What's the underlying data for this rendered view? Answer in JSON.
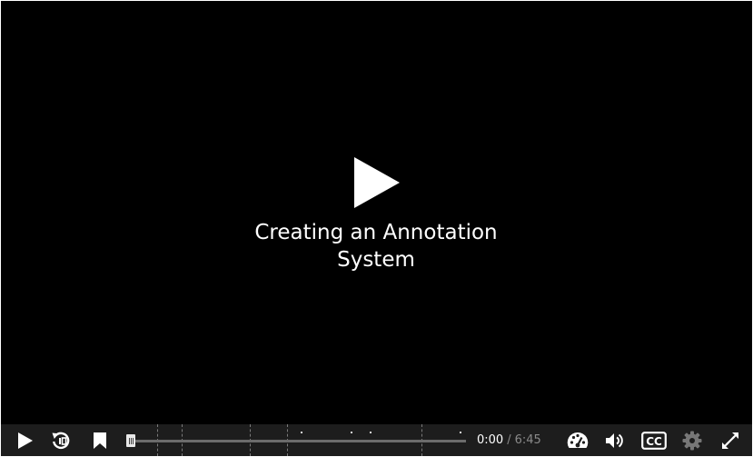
{
  "video": {
    "title": "Creating an Annotation System"
  },
  "icons": {
    "big_play": "play-icon",
    "play": "play-icon",
    "replay": "rewind-10-icon",
    "bookmark": "bookmark-icon",
    "speed": "speedometer-icon",
    "volume": "volume-icon",
    "captions": "closed-captions-icon",
    "settings": "gear-icon",
    "fullscreen": "fullscreen-icon"
  },
  "controls": {
    "captions_label": "CC",
    "settings_enabled": false
  },
  "progress": {
    "played_fraction": 0,
    "chapter_marker_count": 7,
    "annotation_marker_count": 4
  },
  "time": {
    "current": "0:00",
    "separator": "/",
    "duration": "6:45"
  },
  "colors": {
    "video_background": "#000000",
    "control_bar": "#1d1d1d",
    "icon": "#ffffff",
    "icon_disabled": "#777777",
    "time_muted": "#8a8a8a"
  }
}
